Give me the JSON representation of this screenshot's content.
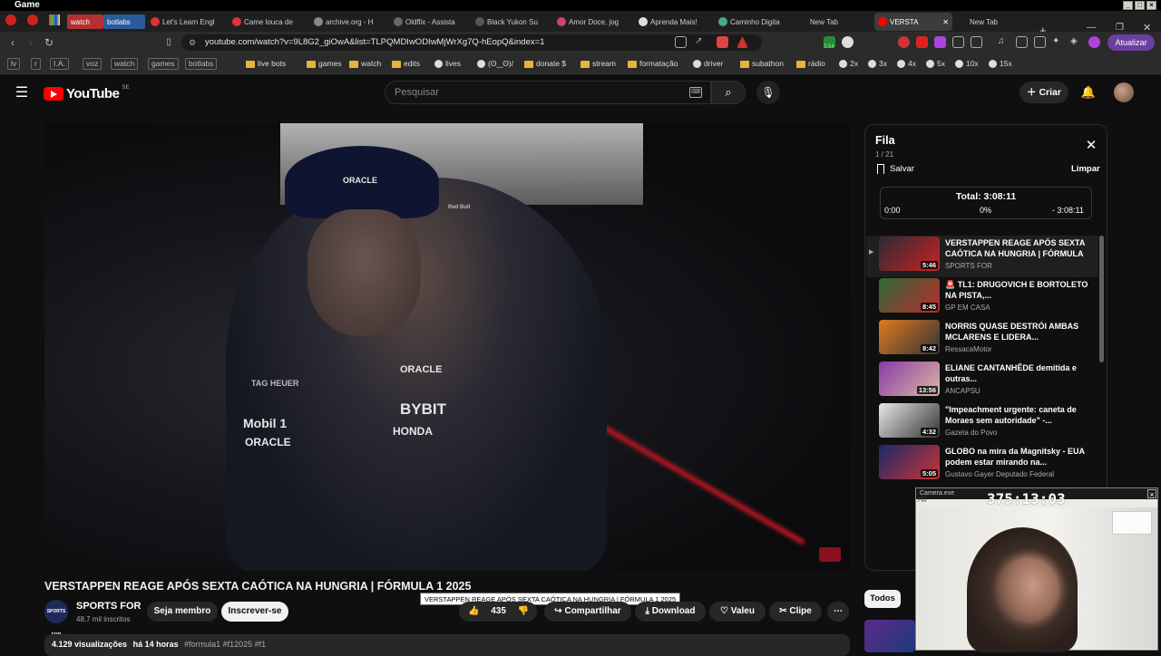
{
  "os": {
    "title": "Game"
  },
  "tabs": [
    {
      "label": "watch",
      "kind": "chip",
      "color": "#b33030"
    },
    {
      "label": "botlabs",
      "kind": "chip",
      "color": "#2a5a9a"
    },
    {
      "label": "Let's Learn Engl",
      "fav": "#d33"
    },
    {
      "label": "Came louca de",
      "fav": "#d33"
    },
    {
      "label": "archive.org - H",
      "fav": "#888"
    },
    {
      "label": "Oldflix - Assista",
      "fav": "#666"
    },
    {
      "label": "Black Yukon Su",
      "fav": "#555"
    },
    {
      "label": "Amor Doce, jog",
      "fav": "#c46"
    },
    {
      "label": "Aprenda Mais!",
      "fav": "#ddd"
    },
    {
      "label": "Caminho Digita",
      "fav": "#4a8"
    },
    {
      "label": "New Tab",
      "fav": "#1f1f1f"
    },
    {
      "label": "VERSTA",
      "fav": "#f00",
      "active": true
    },
    {
      "label": "New Tab",
      "fav": "#1f1f1f"
    }
  ],
  "address": {
    "url": "youtube.com/watch?v=9L8G2_giOwA&list=TLPQMDIwODIwMjWrXg7Q-hEopQ&index=1",
    "update_label": "Atualizar",
    "ext_badge": "5.54"
  },
  "bookmarks": [
    {
      "label": "lv",
      "kind": "box"
    },
    {
      "label": "r",
      "kind": "box"
    },
    {
      "label": "I.A.",
      "kind": "box"
    },
    {
      "label": "voz",
      "kind": "box"
    },
    {
      "label": "watch",
      "kind": "box"
    },
    {
      "label": "games",
      "kind": "box"
    },
    {
      "label": "botlabs",
      "kind": "box"
    },
    {
      "label": "live bots",
      "kind": "folder"
    },
    {
      "label": "games",
      "kind": "folder"
    },
    {
      "label": "watch",
      "kind": "folder"
    },
    {
      "label": "edits",
      "kind": "folder"
    },
    {
      "label": "lives",
      "kind": "icon"
    },
    {
      "label": "(ʘ‿ʘ)/",
      "kind": "icon"
    },
    {
      "label": "donate $",
      "kind": "folder"
    },
    {
      "label": "stream",
      "kind": "folder"
    },
    {
      "label": "formatação",
      "kind": "folder"
    },
    {
      "label": "driver",
      "kind": "icon"
    },
    {
      "label": "subathon",
      "kind": "folder"
    },
    {
      "label": "rádio",
      "kind": "folder"
    },
    {
      "label": "2x",
      "kind": "icon"
    },
    {
      "label": "3x",
      "kind": "icon"
    },
    {
      "label": "4x",
      "kind": "icon"
    },
    {
      "label": "5x",
      "kind": "icon"
    },
    {
      "label": "10x",
      "kind": "icon"
    },
    {
      "label": "15x",
      "kind": "icon"
    }
  ],
  "yt": {
    "logo": "YouTube",
    "country": "SE",
    "search_placeholder": "Pesquisar",
    "create_label": "Criar"
  },
  "video": {
    "title": "VERSTAPPEN REAGE APÓS SEXTA CAÓTICA NA HUNGRIA | FÓRMULA 1 2025",
    "tooltip": "VERSTAPPEN REAGE APÓS SEXTA CAÓTICA NA HUNGRIA | FÓRMULA 1 2025",
    "channel_avatar_text": "SPORTS FOR",
    "channel": "SPORTS FOR",
    "subs": "48,7 mil inscritos",
    "member_label": "Seja membro",
    "subscribe_label": "Inscrever-se",
    "likes": "435",
    "share_label": "Compartilhar",
    "download_label": "Download",
    "thanks_label": "Valeu",
    "clip_label": "Clipe",
    "views": "4.129 visualizações",
    "age": "há 14 horas",
    "tags": "#formula1 #f12025 #f1",
    "suit": {
      "oracle": "ORACLE",
      "redbull": "Red Bull",
      "bybit": "BYBIT",
      "honda": "HONDA",
      "mobil": "Mobil 1",
      "oracle2": "ORACLE",
      "tag": "TAG HEUER"
    }
  },
  "queue": {
    "title": "Fila",
    "count": "1 / 21",
    "save_label": "Salvar",
    "clear_label": "Limpar",
    "total_label": "Total: 3:08:11",
    "start": "0:00",
    "percent": "0%",
    "remaining": "- 3:08:11",
    "items": [
      {
        "title": "VERSTAPPEN REAGE APÓS SEXTA CAÓTICA NA HUNGRIA | FÓRMULA ...",
        "channel": "SPORTS FOR",
        "duration": "5:46",
        "c1": "#2a2a35",
        "c2": "#c22",
        "current": true
      },
      {
        "title": "🚨 TL1: DRUGOVICH E BORTOLETO NA PISTA,...",
        "channel": "GP EM CASA",
        "duration": "8:45",
        "c1": "#2d6b3a",
        "c2": "#bb2a2a"
      },
      {
        "title": "NORRIS QUASE DESTRÓI AMBAS MCLARENS E LIDERA...",
        "channel": "RessacaMotor",
        "duration": "8:42",
        "c1": "#e07a20",
        "c2": "#333"
      },
      {
        "title": "ELIANE CANTANHÊDE demitida e outras...",
        "channel": "ANCAPSU",
        "duration": "13:56",
        "c1": "#8a3aa8",
        "c2": "#d9b8a0"
      },
      {
        "title": "\"Impeachment urgente: caneta de Moraes sem autoridade\" -...",
        "channel": "Gazeta do Povo",
        "duration": "4:32",
        "c1": "#e8e8e8",
        "c2": "#333"
      },
      {
        "title": "GLOBO na mira da Magnitsky - EUA podem estar mirando na...",
        "channel": "Gustavo Gayer Deputado Federal",
        "duration": "5:05",
        "c1": "#1a2a6a",
        "c2": "#c33"
      }
    ]
  },
  "chips": {
    "all": "Todos"
  },
  "camera": {
    "window_title": "Camera.exe",
    "counter": "375:13:03",
    "sub": "File"
  }
}
